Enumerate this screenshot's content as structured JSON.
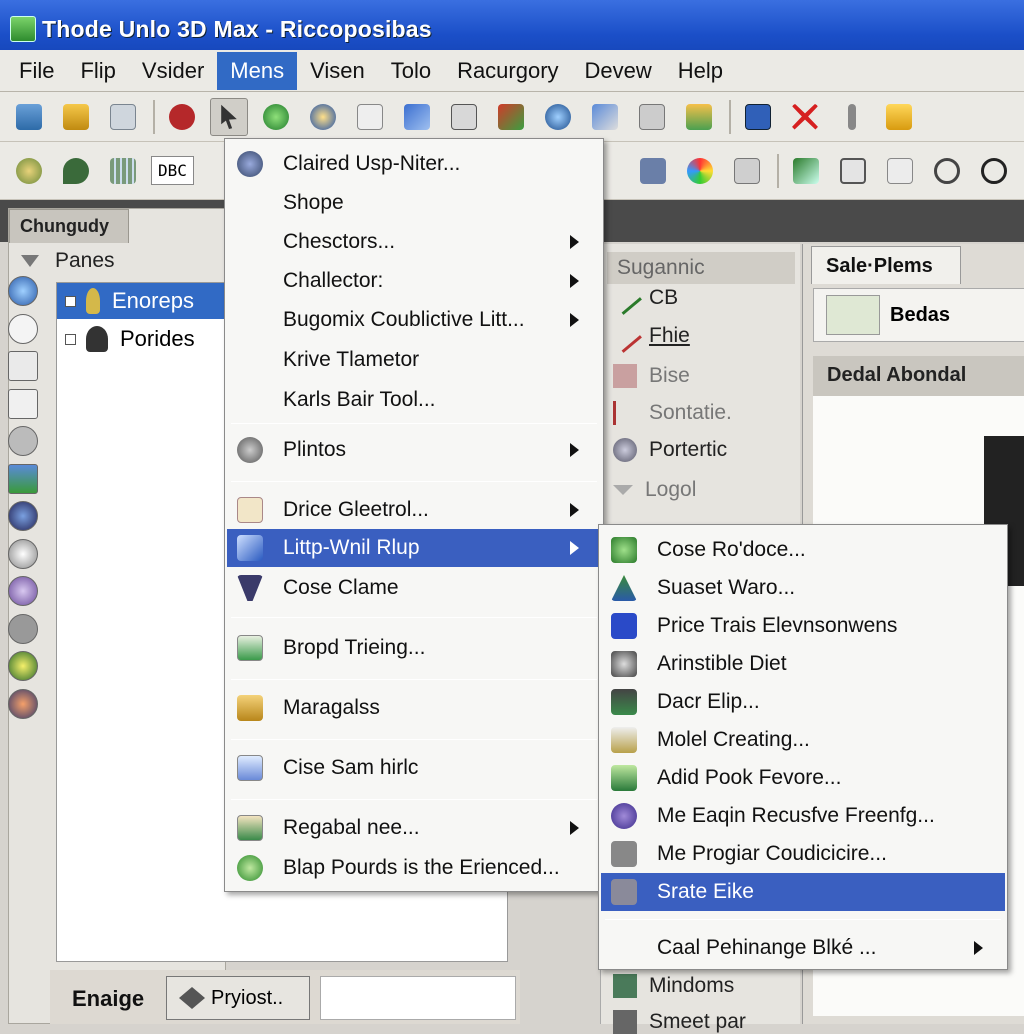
{
  "window": {
    "title": "Thode Unlo 3D Max - Riccoposibas"
  },
  "menubar": {
    "items": [
      "File",
      "Flip",
      "Vsider",
      "Mens",
      "Visen",
      "Tolo",
      "Racurgory",
      "Devew",
      "Help"
    ],
    "active": "Mens"
  },
  "toolbar2": {
    "doc_label": "DBC"
  },
  "left_panel": {
    "tab": "Chungudy",
    "header": "Panes",
    "tree": [
      {
        "label": "Enoreps",
        "selected": true
      },
      {
        "label": "Porides",
        "selected": false
      }
    ],
    "bottom": {
      "label": "Enaige",
      "button": "Pryiost.."
    }
  },
  "mid_panel": {
    "header": "Sugannic",
    "items": [
      "CB",
      "Fhie",
      "Bise",
      "Sontatie.",
      "Portertic",
      "Logol",
      "Mindoms",
      "Smeet par"
    ]
  },
  "right_panel": {
    "tab": "Sale·Plems",
    "button": "Bedas",
    "section": "Dedal Abondal"
  },
  "menu_primary": {
    "items": [
      {
        "label": "Claired Usp-Niter...",
        "submenu": false
      },
      {
        "label": "Shope",
        "submenu": false
      },
      {
        "label": "Chesctors...",
        "submenu": true
      },
      {
        "label": "Challector:",
        "submenu": true
      },
      {
        "label": "Bugomix Coublictive Litt...",
        "submenu": true
      },
      {
        "label": "Krive Tlametor",
        "submenu": false
      },
      {
        "label": "Karls Bair Tool...",
        "submenu": false
      },
      {
        "label": "Plintos",
        "submenu": true
      },
      {
        "label": "Drice Gleetrol...",
        "submenu": true
      },
      {
        "label": "Littp-Wnil Rlup",
        "submenu": true,
        "highlighted": true
      },
      {
        "label": "Cose Clame",
        "submenu": false
      },
      {
        "label": "Bropd Trieing...",
        "submenu": false
      },
      {
        "label": "Maragalss",
        "submenu": false
      },
      {
        "label": "Cise Sam hirlc",
        "submenu": false
      },
      {
        "label": "Regabal nee...",
        "submenu": true
      },
      {
        "label": "Blap Pourds is the Erienced...",
        "submenu": false
      }
    ]
  },
  "menu_sub": {
    "items": [
      {
        "label": "Cose Ro'doce...",
        "submenu": false
      },
      {
        "label": "Suaset Waro...",
        "submenu": false
      },
      {
        "label": "Price Trais Elevnsonwens",
        "submenu": false
      },
      {
        "label": "Arinstible Diet",
        "submenu": false
      },
      {
        "label": "Dacr Elip...",
        "submenu": false
      },
      {
        "label": "Molel Creating...",
        "submenu": false
      },
      {
        "label": "Adid Pook Fevore...",
        "submenu": false
      },
      {
        "label": "Me Eaqin Recusfve Freenfg...",
        "submenu": false
      },
      {
        "label": "Me Progiar Coudicicire...",
        "submenu": false
      },
      {
        "label": "Srate Eike",
        "submenu": false,
        "highlighted": true
      },
      {
        "label": "Caal Pehinange Blké ...",
        "submenu": true
      }
    ]
  },
  "colors": {
    "titlebar": "#1b4fc8",
    "highlight": "#3a5fc0",
    "menu_bg": "#f7f7f5"
  }
}
